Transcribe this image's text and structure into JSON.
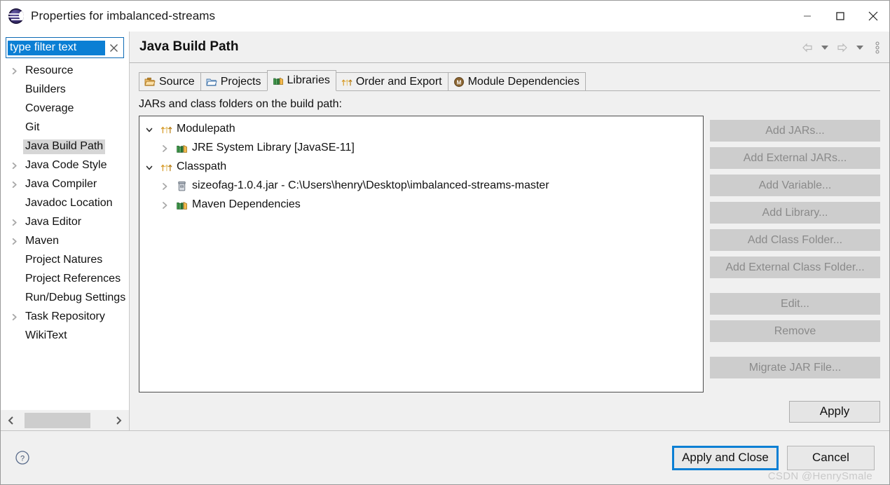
{
  "window": {
    "title": "Properties for imbalanced-streams",
    "icon": "eclipse-logo-icon",
    "controls": {
      "minimize": "minimize-icon",
      "maximize": "maximize-icon",
      "close": "close-icon"
    }
  },
  "sidebar": {
    "filter": {
      "value": "type filter text",
      "placeholder": "type filter text",
      "clear_icon": "clear-icon"
    },
    "items": [
      {
        "label": "Resource",
        "expandable": true,
        "selected": false
      },
      {
        "label": "Builders",
        "expandable": false,
        "selected": false
      },
      {
        "label": "Coverage",
        "expandable": false,
        "selected": false
      },
      {
        "label": "Git",
        "expandable": false,
        "selected": false
      },
      {
        "label": "Java Build Path",
        "expandable": false,
        "selected": true
      },
      {
        "label": "Java Code Style",
        "expandable": true,
        "selected": false
      },
      {
        "label": "Java Compiler",
        "expandable": true,
        "selected": false
      },
      {
        "label": "Javadoc Location",
        "expandable": false,
        "selected": false
      },
      {
        "label": "Java Editor",
        "expandable": true,
        "selected": false
      },
      {
        "label": "Maven",
        "expandable": true,
        "selected": false
      },
      {
        "label": "Project Natures",
        "expandable": false,
        "selected": false
      },
      {
        "label": "Project References",
        "expandable": false,
        "selected": false
      },
      {
        "label": "Run/Debug Settings",
        "expandable": false,
        "selected": false
      },
      {
        "label": "Task Repository",
        "expandable": true,
        "selected": false
      },
      {
        "label": "WikiText",
        "expandable": false,
        "selected": false
      }
    ],
    "scrollbar": {
      "left_icon": "chevron-left-icon",
      "right_icon": "chevron-right-icon"
    }
  },
  "main": {
    "page_title": "Java Build Path",
    "header_tools": [
      {
        "name": "back-arrow-icon"
      },
      {
        "name": "back-dropdown-icon"
      },
      {
        "name": "forward-arrow-icon"
      },
      {
        "name": "forward-dropdown-icon"
      },
      {
        "name": "view-menu-icon"
      }
    ],
    "tabs": [
      {
        "label": "Source",
        "icon": "source-folder-icon",
        "active": false
      },
      {
        "label": "Projects",
        "icon": "open-folder-icon",
        "active": false
      },
      {
        "label": "Libraries",
        "icon": "libraries-books-icon",
        "active": true
      },
      {
        "label": "Order and Export",
        "icon": "order-arrows-icon",
        "active": false
      },
      {
        "label": "Module Dependencies",
        "icon": "module-dependencies-icon",
        "active": false
      }
    ],
    "list_caption": "JARs and class folders on the build path:",
    "classpath_tree": [
      {
        "level": 0,
        "label": "Modulepath",
        "icon": "order-arrows-icon",
        "twisty": "expanded"
      },
      {
        "level": 1,
        "label": "JRE System Library [JavaSE-11]",
        "icon": "libraries-books-icon",
        "twisty": "collapsed"
      },
      {
        "level": 0,
        "label": "Classpath",
        "icon": "order-arrows-icon",
        "twisty": "expanded"
      },
      {
        "level": 1,
        "label": "sizeofag-1.0.4.jar - C:\\Users\\henry\\Desktop\\imbalanced-streams-master",
        "icon": "jar-file-icon",
        "twisty": "collapsed"
      },
      {
        "level": 1,
        "label": "Maven Dependencies",
        "icon": "libraries-books-icon",
        "twisty": "collapsed"
      }
    ],
    "side_buttons": [
      {
        "label": "Add JARs...",
        "enabled": false,
        "gap_above": false
      },
      {
        "label": "Add External JARs...",
        "enabled": false,
        "gap_above": false
      },
      {
        "label": "Add Variable...",
        "enabled": false,
        "gap_above": false
      },
      {
        "label": "Add Library...",
        "enabled": false,
        "gap_above": false
      },
      {
        "label": "Add Class Folder...",
        "enabled": false,
        "gap_above": false
      },
      {
        "label": "Add External Class Folder...",
        "enabled": false,
        "gap_above": false
      },
      {
        "label": "Edit...",
        "enabled": false,
        "gap_above": true
      },
      {
        "label": "Remove",
        "enabled": false,
        "gap_above": false
      },
      {
        "label": "Migrate JAR File...",
        "enabled": false,
        "gap_above": true
      }
    ],
    "apply_label": "Apply"
  },
  "footer": {
    "help_icon": "help-question-icon",
    "apply_and_close_label": "Apply and Close",
    "cancel_label": "Cancel",
    "watermark": "CSDN @HenrySmale"
  },
  "colors": {
    "dialog_bg": "#f0f0f0",
    "panel_bg": "#ffffff",
    "selection_blue": "#0b7fd4",
    "selected_row_gray": "#d6d6d6",
    "disabled_button_bg": "#cdcdcd",
    "disabled_button_text": "#8a8a8a",
    "focus_outline": "#0b7fd4"
  }
}
